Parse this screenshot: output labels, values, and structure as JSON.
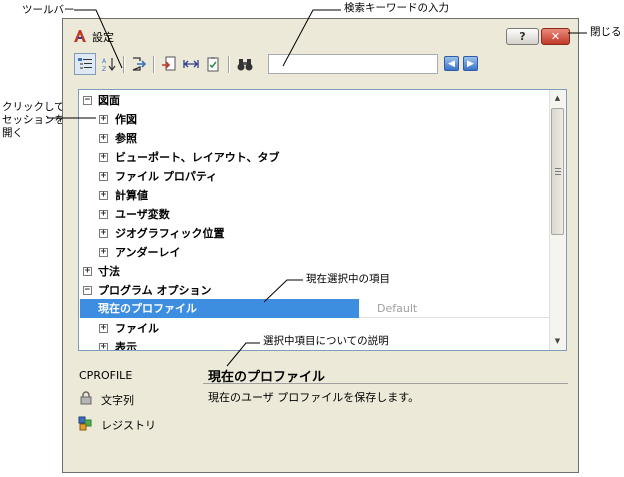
{
  "callouts": {
    "toolbar": "ツールバー",
    "search_input": "検索キーワードの入力",
    "close": "閉じる",
    "click_expand": "クリックして\nセッションを\n開く",
    "current_selection": "現在選択中の項目",
    "selection_description": "選択中項目についての説明"
  },
  "dialog": {
    "title": "設定",
    "help_label": "?",
    "close_label": "✕"
  },
  "search": {
    "value": "",
    "placeholder": ""
  },
  "tree": {
    "rows": [
      {
        "label": "図面",
        "expander": "−"
      },
      {
        "label": "作図",
        "expander": "+"
      },
      {
        "label": "参照",
        "expander": "+"
      },
      {
        "label": "ビューポート、レイアウト、タブ",
        "expander": "+"
      },
      {
        "label": "ファイル プロパティ",
        "expander": "+"
      },
      {
        "label": "計算値",
        "expander": "+"
      },
      {
        "label": "ユーザ変数",
        "expander": "+"
      },
      {
        "label": "ジオグラフィック位置",
        "expander": "+"
      },
      {
        "label": "アンダーレイ",
        "expander": "+"
      },
      {
        "label": "寸法",
        "expander": "+"
      },
      {
        "label": "プログラム オプション",
        "expander": "−"
      },
      {
        "label": "ファイル",
        "expander": "+"
      },
      {
        "label": "表示",
        "expander": "+"
      }
    ],
    "selected": {
      "name": "現在のプロファイル",
      "value": "Default"
    }
  },
  "description": {
    "variable": "CPROFILE",
    "type": "文字列",
    "source": "レジストリ",
    "title": "現在のプロファイル",
    "text": "現在のユーザ プロファイルを保存します。"
  },
  "colors": {
    "selection": "#3d8ee0",
    "dialog_bg": "#ece9d8",
    "close_button": "#c0392b"
  }
}
